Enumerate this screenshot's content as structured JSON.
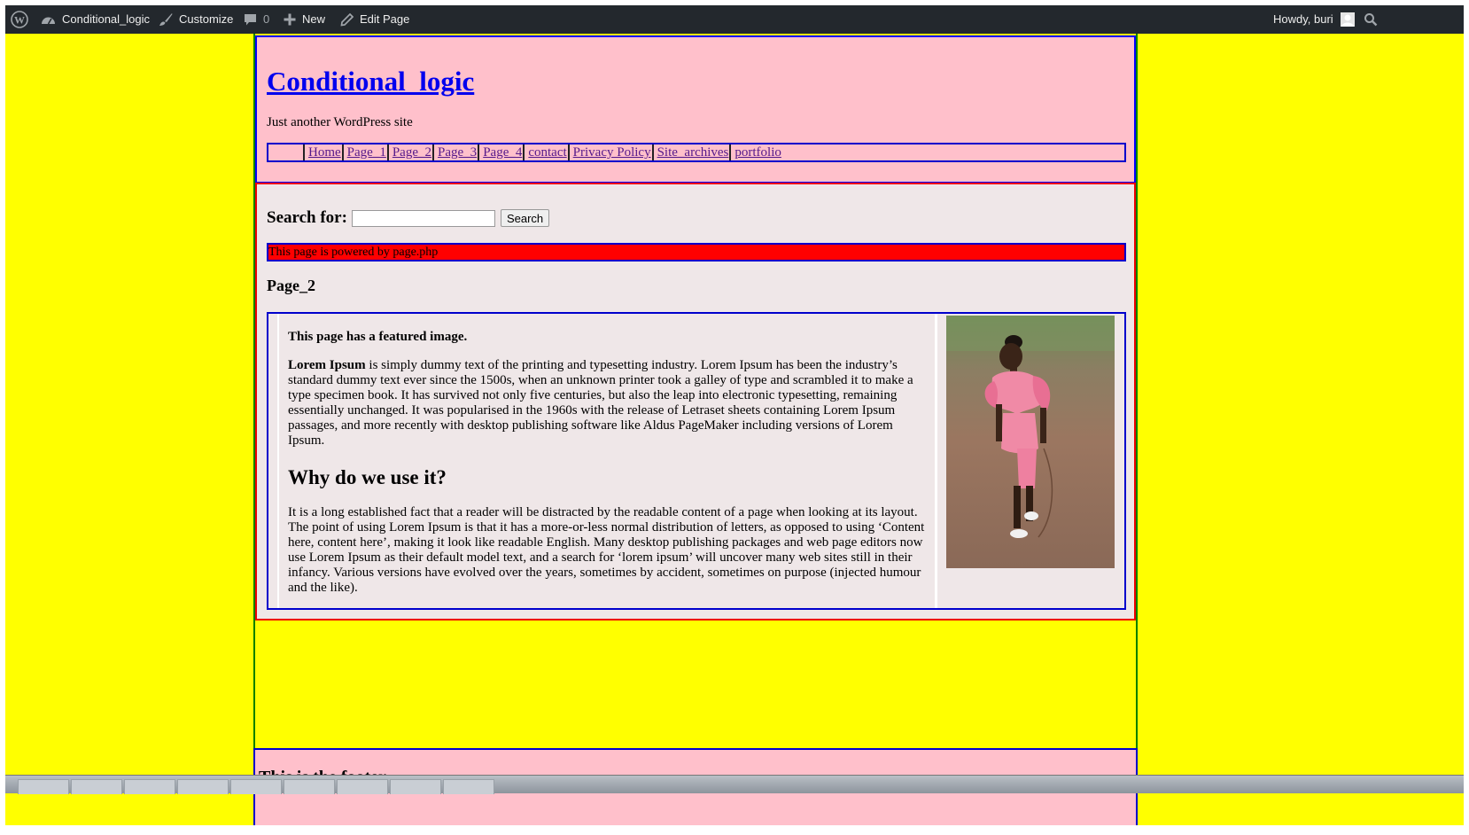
{
  "adminbar": {
    "site_name": "Conditional_logic",
    "customize": "Customize",
    "comments_count": "0",
    "new": "New",
    "edit_page": "Edit Page",
    "greeting": "Howdy, buri"
  },
  "header": {
    "site_title": "Conditional_logic",
    "tagline": "Just another WordPress site",
    "nav": [
      "Home",
      "Page_1",
      "Page_2",
      "Page_3",
      "Page_4",
      "contact",
      "Privacy Policy",
      "Site_archives",
      "portfolio"
    ]
  },
  "search": {
    "label": "Search for:",
    "value": "",
    "button": "Search"
  },
  "powered_notice": "This page is powered by page.php",
  "page": {
    "title": "Page_2",
    "featured_note": "This page has a featured image.",
    "lead_bold": "Lorem Ipsum",
    "lead_rest": " is simply dummy text of the printing and typesetting industry. Lorem Ipsum has been the industry’s standard dummy text ever since the 1500s, when an unknown printer took a galley of type and scrambled it to make a type specimen book. It has survived not only five centuries, but also the leap into electronic typesetting, remaining essentially unchanged. It was popularised in the 1960s with the release of Letraset sheets containing Lorem Ipsum passages, and more recently with desktop publishing software like Aldus PageMaker including versions of Lorem Ipsum.",
    "heading": "Why do we use it?",
    "para2": "It is a long established fact that a reader will be distracted by the readable content of a page when looking at its layout. The point of using Lorem Ipsum is that it has a more-or-less normal distribution of letters, as opposed to using ‘Content here, content here’, making it look like readable English. Many desktop publishing packages and web page editors now use Lorem Ipsum as their default model text, and a search for ‘lorem ipsum’ will uncover many web sites still in their infancy. Various versions have evolved over the years, sometimes by accident, sometimes on purpose (injected humour and the like)."
  },
  "footer": {
    "text": "This is the footer"
  },
  "colors": {
    "page_bg": "#ffff00",
    "header_bg": "#ffc0cb",
    "main_bg": "#efe7e8",
    "notice_bg": "#ff0000",
    "adminbar_bg": "#23282d",
    "link": "#0000ee",
    "visited_link": "#551a8b"
  },
  "icons": [
    "wordpress-logo-icon",
    "dashboard-icon",
    "brush-icon",
    "comment-icon",
    "plus-icon",
    "pencil-icon",
    "avatar-icon",
    "search-icon"
  ]
}
